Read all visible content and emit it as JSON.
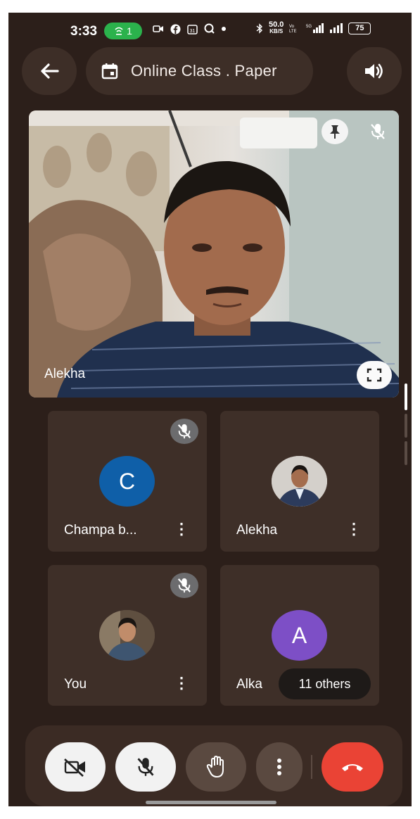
{
  "status_bar": {
    "time": "3:33",
    "call_badge": "1",
    "speed_value": "50.0",
    "speed_unit": "KB/S",
    "battery": "75"
  },
  "header": {
    "title": "Online Class . Paper"
  },
  "main_video": {
    "participant_name": "Alekha"
  },
  "participants": [
    {
      "name": "Champa b...",
      "avatar_letter": "C",
      "avatar_color": "#0f5fa8",
      "muted": true
    },
    {
      "name": "Alekha",
      "avatar_letter": "",
      "avatar_color": "#c9c6c0",
      "muted": false
    },
    {
      "name": "You",
      "avatar_letter": "",
      "avatar_color": "#6b5a4a",
      "muted": true
    },
    {
      "name": "Alka",
      "avatar_letter": "A",
      "avatar_color": "#7d4fc6",
      "muted": false
    }
  ],
  "others_chip": {
    "label": "11 others"
  },
  "controls": {
    "camera_icon": "camera-off-icon",
    "mic_icon": "mic-off-icon",
    "raise_hand_icon": "raise-hand-icon",
    "more_icon": "more-vertical-icon",
    "end_call_icon": "end-call-icon",
    "end_call_color": "#ea4335"
  }
}
